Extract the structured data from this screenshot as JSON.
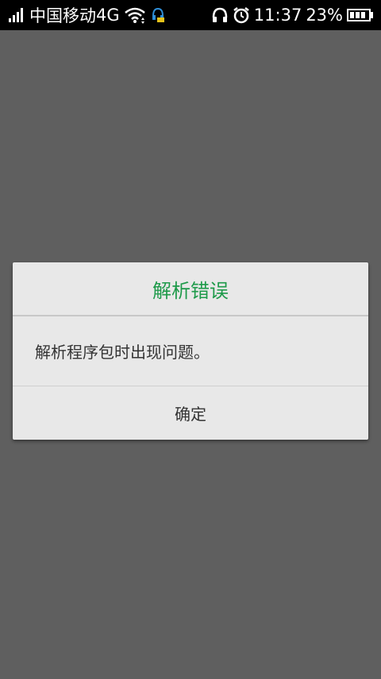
{
  "status_bar": {
    "carrier": "中国移动",
    "network": "4G",
    "time": "11:37",
    "battery_percent": "23%",
    "battery_level": 0.23,
    "icons": [
      "signal-icon",
      "wifi-icon",
      "sync-icon",
      "headphones-icon",
      "alarm-icon",
      "battery-icon"
    ]
  },
  "dialog": {
    "title": "解析错误",
    "message": "解析程序包时出现问题。",
    "confirm_label": "确定",
    "title_color": "#1e9a4a"
  }
}
